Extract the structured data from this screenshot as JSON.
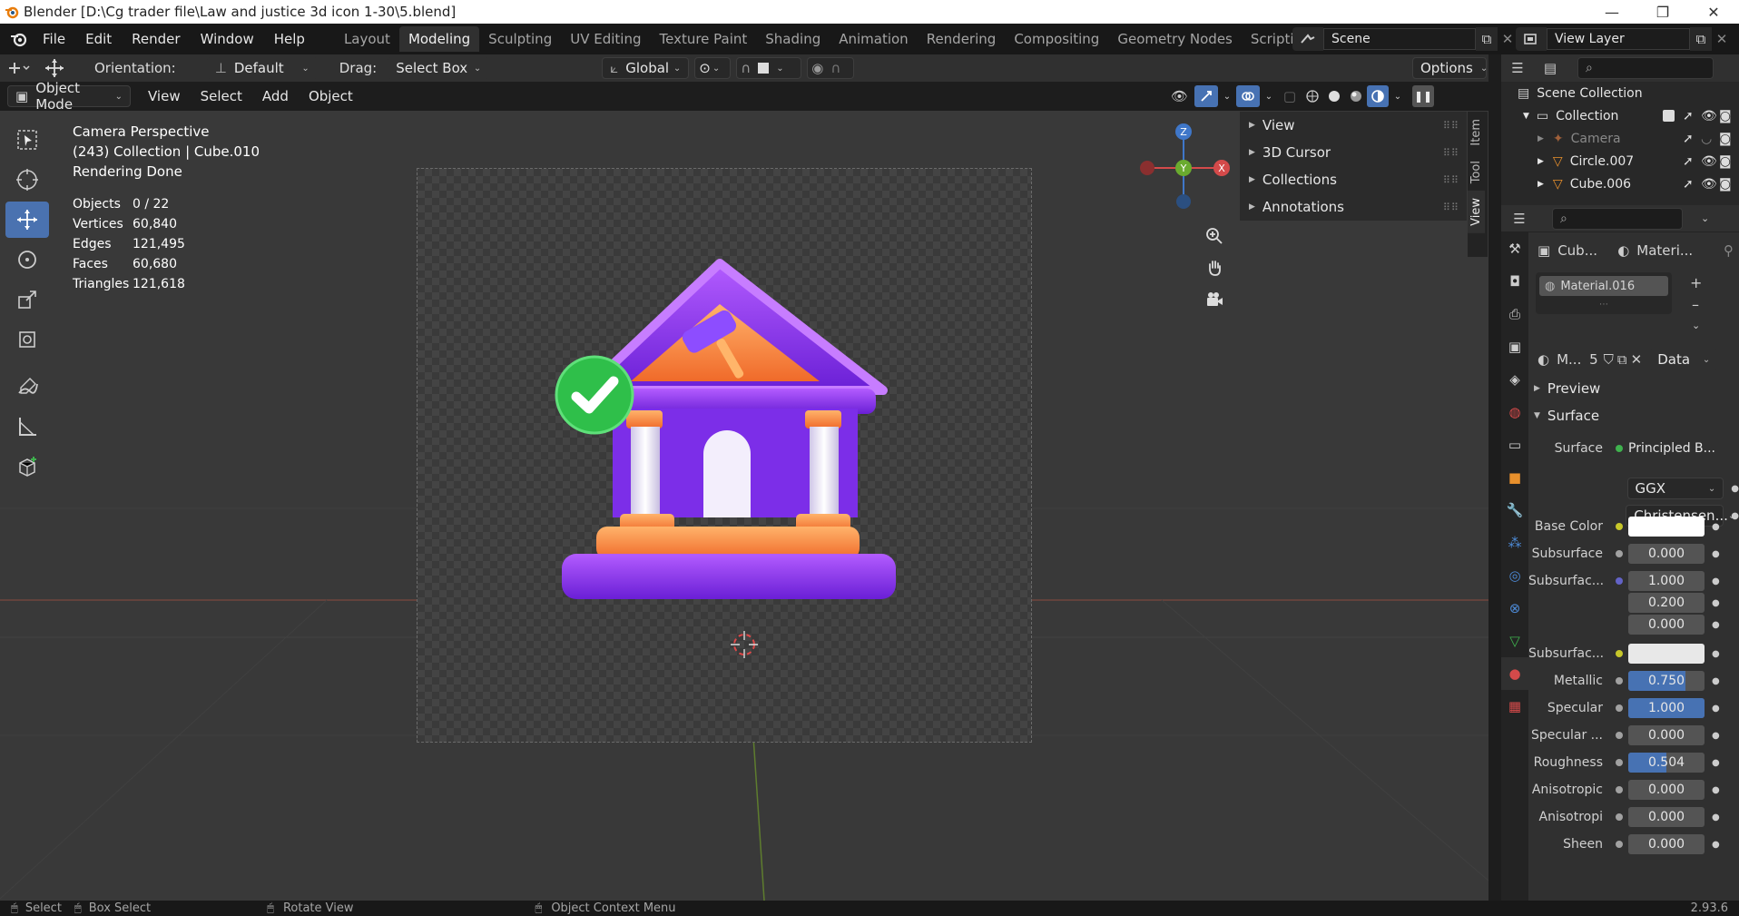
{
  "window": {
    "title": "Blender [D:\\Cg trader file\\Law and justice 3d icon 1-30\\5.blend]"
  },
  "menu": [
    "File",
    "Edit",
    "Render",
    "Window",
    "Help"
  ],
  "workspaces": [
    "Layout",
    "Modeling",
    "Sculpting",
    "UV Editing",
    "Texture Paint",
    "Shading",
    "Animation",
    "Rendering",
    "Compositing",
    "Geometry Nodes",
    "Scripting"
  ],
  "active_workspace": "Modeling",
  "scene": {
    "name": "Scene",
    "view_layer": "View Layer"
  },
  "header": {
    "orientation_label": "Orientation:",
    "orientation_value": "Default",
    "drag_label": "Drag:",
    "drag_value": "Select Box",
    "transform_orientation": "Global",
    "options_label": "Options"
  },
  "viewport_header": {
    "mode": "Object Mode",
    "menus": [
      "View",
      "Select",
      "Add",
      "Object"
    ]
  },
  "viewport_overlay": {
    "perspective": "Camera Perspective",
    "collection": "(243) Collection | Cube.010",
    "status": "Rendering Done"
  },
  "stats": [
    {
      "label": "Objects",
      "value": "0 / 22"
    },
    {
      "label": "Vertices",
      "value": "60,840"
    },
    {
      "label": "Edges",
      "value": "121,495"
    },
    {
      "label": "Faces",
      "value": "60,680"
    },
    {
      "label": "Triangles",
      "value": "121,618"
    }
  ],
  "sidebar_panels": [
    "View",
    "3D Cursor",
    "Collections",
    "Annotations"
  ],
  "sidebar_tabs": [
    "Item",
    "Tool",
    "View"
  ],
  "gizmo": {
    "z": "Z",
    "y": "Y",
    "x": "X"
  },
  "outliner": {
    "scene_collection": "Scene Collection",
    "items": [
      {
        "name": "Collection"
      },
      {
        "name": "Camera"
      },
      {
        "name": "Circle.007"
      },
      {
        "name": "Cube.006"
      }
    ]
  },
  "properties": {
    "object_short": "Cub...",
    "material_short": "Materi...",
    "material_slot": "Material.016",
    "material_name_short": "M...",
    "users": "5",
    "link": "Data",
    "sections": {
      "preview": "Preview",
      "surface": "Surface"
    },
    "surface_label": "Surface",
    "surface_shader": "Principled B...",
    "distribution": "GGX",
    "subsurface_method": "Christensen...",
    "fields": [
      {
        "label": "Base Color",
        "type": "color",
        "color": "#ffffff",
        "dot": "y"
      },
      {
        "label": "Subsurface",
        "type": "num",
        "value": "0.000",
        "fill": 0
      },
      {
        "label": "Subsurfac...",
        "type": "num",
        "value": "1.000",
        "fill": 0,
        "dot": "p"
      },
      {
        "label": "",
        "type": "num",
        "value": "0.200",
        "fill": 0,
        "nodot": true
      },
      {
        "label": "",
        "type": "num",
        "value": "0.000",
        "fill": 0,
        "nodot": true
      },
      {
        "label": "Subsurfac...",
        "type": "color",
        "color": "#e8e8e8",
        "dot": "y"
      },
      {
        "label": "Metallic",
        "type": "num",
        "value": "0.750",
        "fill": 0.75
      },
      {
        "label": "Specular",
        "type": "num",
        "value": "1.000",
        "fill": 1.0
      },
      {
        "label": "Specular ...",
        "type": "num",
        "value": "0.000",
        "fill": 0
      },
      {
        "label": "Roughness",
        "type": "num",
        "value": "0.504",
        "fill": 0.504
      },
      {
        "label": "Anisotropic",
        "type": "num",
        "value": "0.000",
        "fill": 0
      },
      {
        "label": "Anisotropi",
        "type": "num",
        "value": "0.000",
        "fill": 0
      },
      {
        "label": "Sheen",
        "type": "num",
        "value": "0.000",
        "fill": 0
      }
    ]
  },
  "statusbar": {
    "select": "Select",
    "box_select": "Box Select",
    "rotate": "Rotate View",
    "context": "Object Context Menu",
    "version": "2.93.6"
  }
}
